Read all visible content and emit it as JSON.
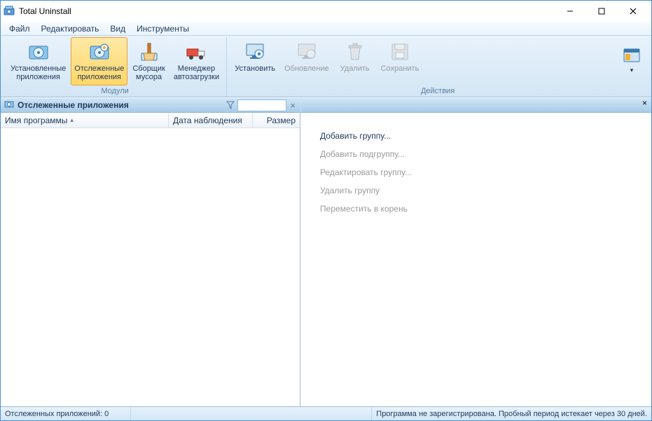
{
  "window": {
    "title": "Total Uninstall"
  },
  "menu": {
    "file": "Файл",
    "edit": "Редактировать",
    "view": "Вид",
    "tools": "Инструменты"
  },
  "ribbon": {
    "group_modules": "Модули",
    "group_actions": "Действия",
    "installed": "Установленные\nприложения",
    "monitored": "Отслеженные\nприложения",
    "cleaner": "Сборщик\nмусора",
    "autorun": "Менеджер\nавтозагрузки",
    "install": "Установить",
    "update": "Обновление",
    "delete": "Удалить",
    "save": "Сохранить"
  },
  "panel": {
    "title": "Отслеженные приложения",
    "filter_value": ""
  },
  "columns": {
    "name": "Имя программы",
    "date": "Дата наблюдения",
    "size": "Размер"
  },
  "context": {
    "add_group": "Добавить группу...",
    "add_subgroup": "Добавить подгруппу...",
    "edit_group": "Редактировать группу...",
    "delete_group": "Удалить группу",
    "move_root": "Переместить в корень"
  },
  "status": {
    "count": "Отслеженных приложений: 0",
    "trial": "Программа не зарегистрирована. Пробный период истекает через 30 дней."
  }
}
